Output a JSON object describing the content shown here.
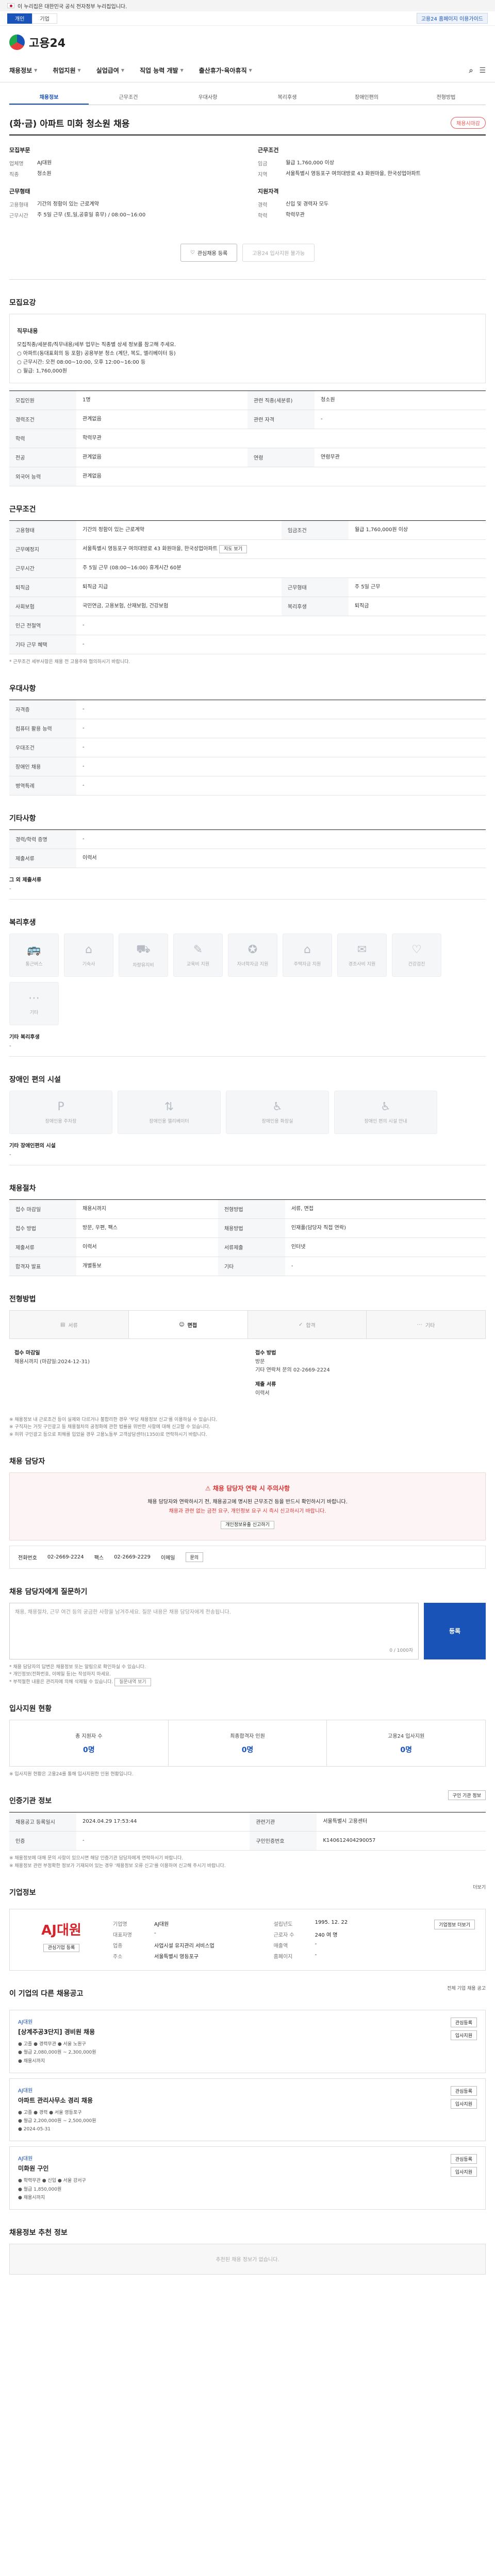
{
  "banner": {
    "text": "이 누리집은 대한민국 공식 전자정부 누리집입니다."
  },
  "util": {
    "tabs": [
      "개인",
      "기업"
    ],
    "right_btn": "고용24 홈페이지 이용가이드"
  },
  "logo": {
    "text": "고용24"
  },
  "gnb": [
    "채용정보",
    "취업지원",
    "실업급여",
    "직업 능력 개발",
    "출산휴가·육아휴직"
  ],
  "subtabs": [
    "채용정보",
    "근무조건",
    "우대사항",
    "복리후생",
    "장애인편의",
    "전형방법"
  ],
  "job": {
    "title": "(화·금) 아파트 미화 청소원 채용",
    "status": "채용시마감",
    "company_label": "모집부문",
    "work_label": "근무조건",
    "recruit_label": "지원자격",
    "company_rows": [
      {
        "k": "업체명",
        "v": "AJ대원"
      },
      {
        "k": "직종",
        "v": "청소원"
      }
    ],
    "work_rows": [
      {
        "k": "임금",
        "v": "월급 1,760,000 이상"
      },
      {
        "k": "지역",
        "v": "서울특별시 영등포구 여의대방로 43 화원마을, 한국성업아파트"
      }
    ],
    "qual_rows": [
      {
        "k": "경력",
        "v": "신입 및 경력자 모두"
      },
      {
        "k": "학력",
        "v": "학력무관"
      }
    ],
    "hours_label": "근무형태",
    "hours_rows": [
      {
        "k": "고용형태",
        "v": "기간의 정함이 있는 근로계약"
      },
      {
        "k": "근무시간",
        "v": "주 5일 근무 (토,일,공휴일 휴무) / 08:00~16:00"
      }
    ],
    "btn_interest": "관심채용 등록",
    "btn_apply": "고용24 입사지원 불가능"
  },
  "recruit": {
    "section": "모집요강",
    "duty_title": "직무내용",
    "duty_text": "모집직종/세분류/직무내용/세부 업무는 직종별 상세 정보를 참고해 주세요.",
    "duty_desc_1": "○ 아파트(동대표회의 등 포함) 공용부분 청소 (계단, 복도, 엘리베이터 등)",
    "duty_desc_2": "○ 근무시간: 오전 08:00~10:00, 오후 12:00~16:00 등",
    "duty_desc_3": "○ 월급: 1,760,000원",
    "rows": [
      {
        "k": "모집인원",
        "v": "1명",
        "k2": "관련 직종(세분류)",
        "v2": "청소원"
      },
      {
        "k": "경력조건",
        "v": "관계없음",
        "k2": "관련 자격",
        "v2": "-"
      },
      {
        "k": "학력",
        "v": "학력무관",
        "k2": "",
        "v2": ""
      },
      {
        "k": "전공",
        "v": "관계없음",
        "k2": "연령",
        "v2": "연령무관"
      },
      {
        "k": "외국어 능력",
        "v": "관계없음",
        "k2": "",
        "v2": ""
      }
    ]
  },
  "work": {
    "section": "근무조건",
    "rows": [
      {
        "k": "고용형태",
        "v": "기간의 정함이 있는 근로계약",
        "k2": "임금조건",
        "v2": "월급 1,760,000원 이상"
      },
      {
        "k": "근무예정지",
        "v": "서울특별시 영등포구 여의대방로 43 화원마을, 한국성업아파트"
      },
      {
        "k": "근무시간",
        "v": "주 5일 근무 (08:00~16:00) 휴게시간 60분"
      },
      {
        "k": "퇴직금",
        "v": "퇴직금 지급",
        "k2": "근무형태",
        "v2": "주 5일 근무"
      },
      {
        "k": "사회보험",
        "v": "국민연금, 고용보험, 산재보험, 건강보험",
        "k2": "복리후생",
        "v2": "퇴직금"
      },
      {
        "k": "인근 전철역",
        "v": "-"
      },
      {
        "k": "기타 근무 혜택",
        "v": "-"
      }
    ],
    "note": "* 근무조건 세부사항은 채용 전 고용주와 협의하시기 바랍니다."
  },
  "pref": {
    "section": "우대사항",
    "rows": [
      {
        "k": "자격증",
        "v": "-"
      },
      {
        "k": "컴퓨터 활용 능력",
        "v": "-"
      },
      {
        "k": "우대조건",
        "v": "-"
      },
      {
        "k": "장애인 채용",
        "v": "-"
      },
      {
        "k": "병역특례",
        "v": "-"
      }
    ]
  },
  "etc": {
    "section": "기타사항",
    "rows": [
      {
        "k": "경력/학력 증명",
        "v": "-"
      },
      {
        "k": "제출서류",
        "v": "이력서"
      }
    ],
    "etc_title": "그 외 제출서류",
    "etc_val": "-"
  },
  "welfare": {
    "section": "복리후생",
    "items": [
      "통근버스",
      "기숙사",
      "차량유지비",
      "교육비 지원",
      "자녀학자금 지원",
      "주택자금 지원",
      "경조사비 지원",
      "건강검진",
      "기타"
    ],
    "selected_label": "기타 복리후생",
    "selected_val": "-"
  },
  "disability": {
    "section": "장애인 편의 시설",
    "items": [
      "장애인용 주차장",
      "장애인용 엘리베이터",
      "장애인용 화장실",
      "장애인 편의 시설 안내"
    ],
    "selected_label": "기타 장애인편의 시설",
    "selected_val": "-"
  },
  "process": {
    "section": "채용절차",
    "rows": [
      {
        "k": "접수 마감일",
        "v": "채용시까지",
        "k2": "전형방법",
        "v2": "서류, 면접"
      },
      {
        "k": "접수 방법",
        "v": "방문, 우편, 팩스",
        "k2": "채용방법",
        "v2": "인재풀(담당자 직접 연락)"
      },
      {
        "k": "제출서류",
        "v": "이력서",
        "k2": "서류제출",
        "v2": "인터넷"
      },
      {
        "k": "합격자 발표",
        "v": "개별통보",
        "k2": "기타",
        "v2": "-"
      }
    ]
  },
  "steps": {
    "section": "전형방법",
    "items": [
      "서류",
      "면접",
      "합격",
      "기타"
    ]
  },
  "apply": {
    "left_k": "접수 마감일",
    "left_v": "채용시까지 (마감일:2024-12-31)",
    "right_k": "접수 방법",
    "right_v1": "방문",
    "right_v2": "기타 연락처 문의 02-2669-2224",
    "right_k2": "제출 서류",
    "right_v3": "이력서",
    "notes": [
      "※ 채용정보 내 근로조건 등이 실제와 다르거나 불합리한 경우 '부당 채용정보 신고'를 이용하실 수 있습니다.",
      "※ 구직자는 거짓 구인광고 등 채용절차의 공정화에 관한 법률을 위반한 사항에 대해 신고할 수 있습니다.",
      "※ 허위 구인광고 등으로 피해를 입었을 경우 고용노동부 고객상담센터(1350)로 연락하시기 바랍니다."
    ]
  },
  "contact": {
    "section": "채용 담당자",
    "warn_title": "채용 담당자 연락 시 주의사항",
    "warn_text_1": "채용 담당자와 연락하시기 전, 채용공고에 명시된 근무조건 등을 반드시 확인하시기 바랍니다.",
    "warn_text_2": "채용과 관련 없는 금전 요구, 개인정보 요구 시 즉시 신고하시기 바랍니다.",
    "warn_btn": "개인정보유출 신고하기",
    "phone_k": "전화번호",
    "phone_v": "02-2669-2224",
    "fax_k": "팩스",
    "fax_v": "02-2669-2229",
    "mini_btn": "문의",
    "name_k": "이메일",
    "name_v": ""
  },
  "qa": {
    "section": "채용 담당자에게 질문하기",
    "placeholder": "채용, 채용절차, 근무 여건 등의 궁금한 사항을 남겨주세요. 질문 내용은 채용 담당자에게 전송됩니다.",
    "count": "0 / 1000자",
    "submit": "등록",
    "notes": [
      "* 채용 담당자의 답변은 채용정보 또는 알림으로 확인하실 수 있습니다.",
      "* 개인정보(전화번호, 이메일 등)는 작성하지 마세요.",
      "* 부적절한 내용은 관리자에 의해 삭제될 수 있습니다."
    ],
    "note_btn": "질문내역 보기"
  },
  "status": {
    "section": "입사지원 현황",
    "stats": [
      {
        "label": "총 지원자 수",
        "value": "0명"
      },
      {
        "label": "최종합격자 인원",
        "value": "0명"
      },
      {
        "label": "고용24 입사지원",
        "value": "0명"
      }
    ],
    "note": "※ 입사지원 현황은 고용24를 통해 입사지원한 인원 현황입니다."
  },
  "posting": {
    "section": "인증기관 정보",
    "rows": [
      {
        "k": "채용공고 등록일시",
        "v": "2024.04.29 17:53:44",
        "k2": "관련기관",
        "v2": "서울특별시 고용센터"
      },
      {
        "k": "인증",
        "v": "-",
        "k2": "구인인증번호",
        "v2": "K140612404290057"
      }
    ],
    "btn_right": "구인 기관 정보",
    "notes": [
      "※ 채용정보에 대해 문의 사항이 있으시면 해당 인증기관 담당자에게 연락하시기 바랍니다.",
      "※ 채용정보 관련 부정확한 정보가 기재되어 있는 경우 '채용정보 오류 신고'를 이용하여 신고해 주시기 바랍니다."
    ]
  },
  "company": {
    "section": "기업정보",
    "more": "더보기",
    "logo": "AJ대원",
    "rows": [
      {
        "k": "기업명",
        "v": "AJ대원"
      },
      {
        "k": "대표자명",
        "v": "-"
      },
      {
        "k": "업종",
        "v": "사업시설 유지관리 서비스업"
      },
      {
        "k": "설립년도",
        "v": "1995. 12. 22"
      },
      {
        "k": "근로자 수",
        "v": "240 여 명"
      },
      {
        "k": "매출액",
        "v": "-"
      },
      {
        "k": "주소",
        "v": "서울특별시 영등포구"
      },
      {
        "k": "홈페이지",
        "v": "-"
      }
    ],
    "btn_follow": "관심기업 등록",
    "btn_info": "기업정보 더보기"
  },
  "other": {
    "section": "이 기업의 다른 채용공고",
    "right_note": "전체 기업 채용 공고",
    "items": [
      {
        "name": "AJ대원",
        "title": "[상계주공3단지] 경비원 채용",
        "meta_1": "● 고졸  ● 경력무관  ● 서울 노원구",
        "meta_2": "● 월급 2,080,000원 ~ 2,300,000원",
        "meta_3": "● 채용시까지",
        "btn_1": "관심등록",
        "btn_2": "입사지원"
      },
      {
        "name": "AJ대원",
        "title": "아파트 관리사무소 경리 채용",
        "meta_1": "● 고졸  ● 경력  ● 서울 영등포구",
        "meta_2": "● 월급 2,200,000원 ~ 2,500,000원",
        "meta_3": "● 2024-05-31",
        "btn_1": "관심등록",
        "btn_2": "입사지원"
      },
      {
        "name": "AJ대원",
        "title": "미화원 구인",
        "meta_1": "● 학력무관  ● 신입  ● 서울 강서구",
        "meta_2": "● 월급 1,850,000원",
        "meta_3": "● 채용시까지",
        "btn_1": "관심등록",
        "btn_2": "입사지원"
      }
    ]
  },
  "recommend": {
    "section": "채용정보 추천 정보",
    "empty": "추천된 채용 정보가 없습니다."
  }
}
